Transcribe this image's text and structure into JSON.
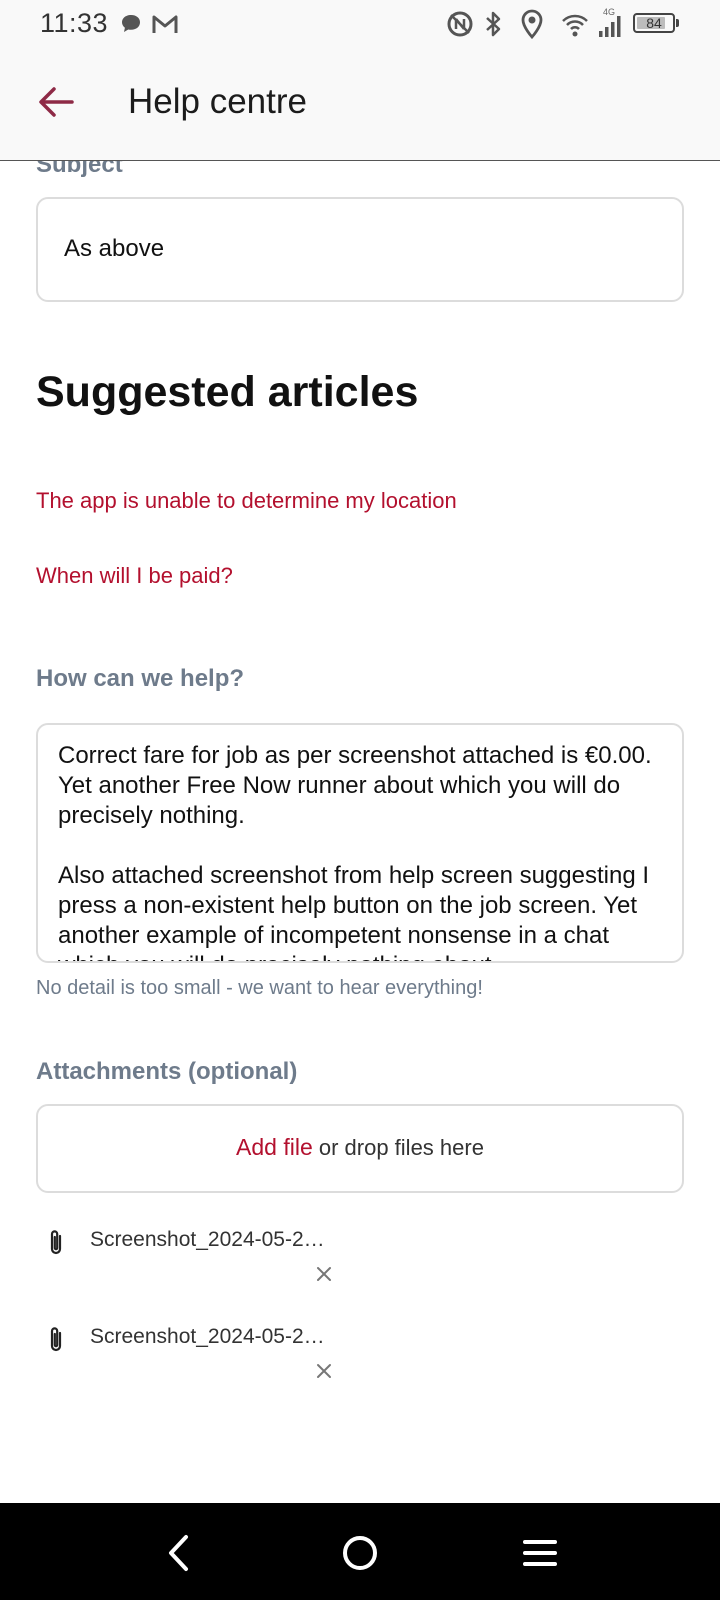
{
  "status_bar": {
    "time": "11:33",
    "network": "4G",
    "battery": "84",
    "battery_level": 0.84,
    "icons": [
      "chat-icon",
      "gmail-icon",
      "nfc-icon",
      "bluetooth-icon",
      "location-icon",
      "wifi-icon",
      "signal-icon",
      "battery-icon"
    ]
  },
  "app_bar": {
    "title": "Help centre",
    "back_icon": "arrow-left-icon"
  },
  "form": {
    "subject_label": "Subject",
    "subject_value": "As above",
    "suggested_title": "Suggested articles",
    "articles": [
      "The app is unable to determine my location",
      "When will I be paid?"
    ],
    "help_label": "How can we help?",
    "help_text": "Correct fare for job as per screenshot attached is €0.00. Yet another Free Now runner about which you will do precisely nothing.\n\nAlso attached screenshot from help screen suggesting I press a non-existent help button on the job screen. Yet another example of incompetent nonsense in a chat which you will do precisely nothing about.",
    "hint": "No detail is too small - we want to hear everything!",
    "attachments_label": "Attachments (optional)",
    "add_file": "Add file",
    "drop_text": " or drop files here",
    "attachments": [
      {
        "name": "Screenshot_2024-05-2…"
      },
      {
        "name": "Screenshot_2024-05-2…"
      }
    ]
  },
  "colors": {
    "accent": "#b3102e",
    "label": "#6e7b8b",
    "back_arrow": "#8e2a46"
  },
  "nav_bar": {
    "icons": [
      "back-icon",
      "home-icon",
      "menu-icon"
    ]
  }
}
